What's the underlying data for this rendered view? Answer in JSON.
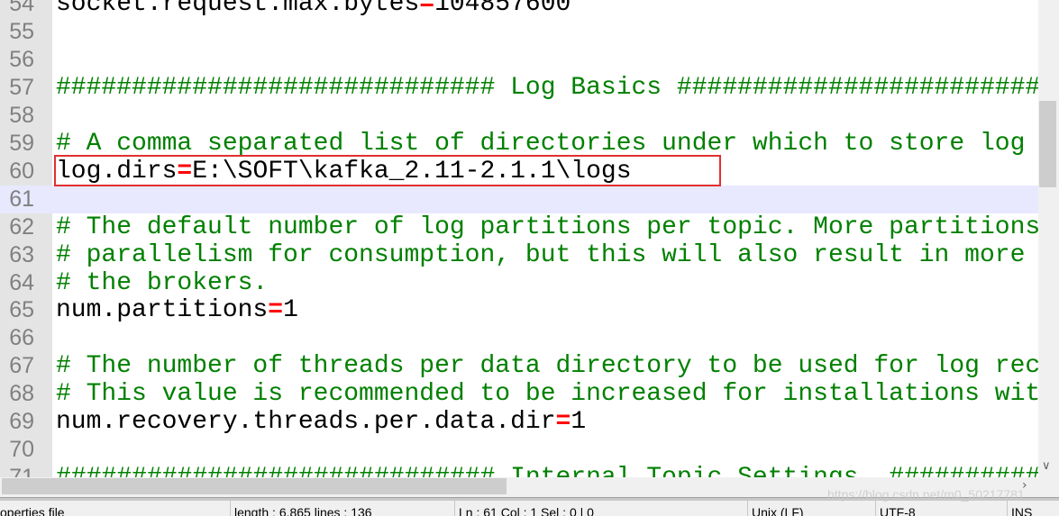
{
  "editor": {
    "current_line": 61,
    "lines": [
      {
        "n": "54",
        "segs": [
          [
            "key",
            "socket.request.max.bytes"
          ],
          [
            "op",
            "="
          ],
          [
            "val",
            "104857600"
          ]
        ]
      },
      {
        "n": "55",
        "segs": []
      },
      {
        "n": "56",
        "segs": []
      },
      {
        "n": "57",
        "segs": [
          [
            "comment",
            "############################# Log Basics #############################"
          ]
        ]
      },
      {
        "n": "58",
        "segs": []
      },
      {
        "n": "59",
        "segs": [
          [
            "comment",
            "# A comma separated list of directories under which to store log files"
          ]
        ]
      },
      {
        "n": "60",
        "segs": [
          [
            "key",
            "log.dirs"
          ],
          [
            "op",
            "="
          ],
          [
            "val",
            "E:\\SOFT\\kafka_2.11-2.1.1\\logs"
          ]
        ]
      },
      {
        "n": "61",
        "segs": []
      },
      {
        "n": "62",
        "segs": [
          [
            "comment",
            "# The default number of log partitions per topic. More partitions allow greater"
          ]
        ]
      },
      {
        "n": "63",
        "segs": [
          [
            "comment",
            "# parallelism for consumption, but this will also result in more files across"
          ]
        ]
      },
      {
        "n": "64",
        "segs": [
          [
            "comment",
            "# the brokers."
          ]
        ]
      },
      {
        "n": "65",
        "segs": [
          [
            "key",
            "num.partitions"
          ],
          [
            "op",
            "="
          ],
          [
            "val",
            "1"
          ]
        ]
      },
      {
        "n": "66",
        "segs": []
      },
      {
        "n": "67",
        "segs": [
          [
            "comment",
            "# The number of threads per data directory to be used for log recovery at startup"
          ]
        ]
      },
      {
        "n": "68",
        "segs": [
          [
            "comment",
            "# This value is recommended to be increased for installations with data dirs"
          ]
        ]
      },
      {
        "n": "69",
        "segs": [
          [
            "key",
            "num.recovery.threads.per.data.dir"
          ],
          [
            "op",
            "="
          ],
          [
            "val",
            "1"
          ]
        ]
      },
      {
        "n": "70",
        "segs": []
      },
      {
        "n": "71",
        "segs": [
          [
            "comment",
            "############################# Internal Topic Settings  #############################"
          ]
        ]
      }
    ]
  },
  "status_bar": {
    "file_type": "operties file",
    "length_lines": "length : 6,865    lines : 136",
    "position": "Ln : 61    Col : 1    Sel : 0 | 0",
    "eol": "Unix (LF)",
    "encoding": "UTF-8",
    "mode": "INS"
  },
  "watermark": "https://blog.csdn.net/m0_50217781",
  "colors": {
    "comment": "#008000",
    "operator": "#ff0000",
    "current_line": "#e8e8ff",
    "highlight_box": "#e03030"
  }
}
